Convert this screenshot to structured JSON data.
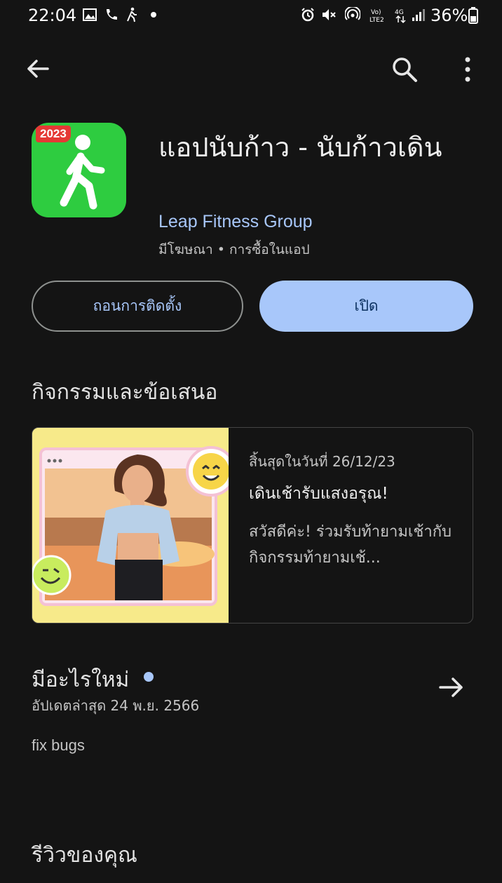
{
  "status_bar": {
    "time": "22:04",
    "battery": "36%"
  },
  "app_bar": {
    "back_icon": "arrow-left-icon",
    "search_icon": "search-icon",
    "more_icon": "more-vert-icon"
  },
  "app": {
    "icon_badge": "2023",
    "title": "แอปนับก้าว - นับก้าวเดิน",
    "developer": "Leap Fitness Group",
    "meta": "มีโฆษณา • การซื้อในแอป",
    "icon_color": "#2ecc40"
  },
  "actions": {
    "uninstall_label": "ถอนการติดตั้ง",
    "open_label": "เปิด"
  },
  "events": {
    "heading": "กิจกรรมและข้อเสนอ",
    "card": {
      "date": "สิ้นสุดในวันที่ 26/12/23",
      "title": "เดินเช้ารับแสงอรุณ!",
      "description": "สวัสดีค่ะ! ร่วมรับท้ายามเช้ากับกิจกรรมท้ายามเช้..."
    }
  },
  "whats_new": {
    "heading": "มีอะไรใหม่",
    "updated": "อัปเดตล่าสุด 24 พ.ย. 2566",
    "notes": "fix bugs"
  },
  "reviews": {
    "heading": "รีวิวของคุณ"
  },
  "colors": {
    "background": "#141414",
    "accent": "#a8c7fa",
    "open_button_text": "#0b305f"
  }
}
